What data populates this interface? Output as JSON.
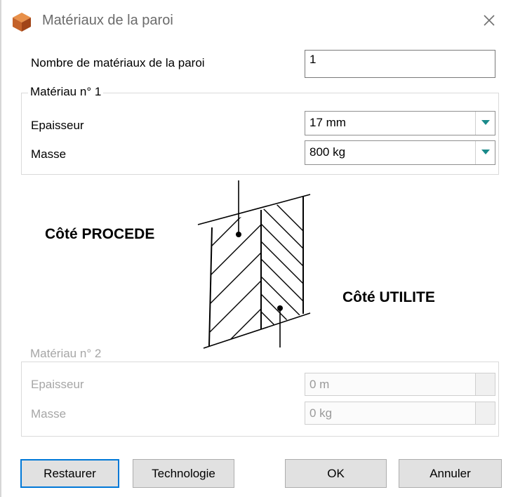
{
  "window": {
    "title": "Matériaux de la paroi",
    "app_icon": "cube-icon",
    "close_icon": "close-icon"
  },
  "count": {
    "label": "Nombre de matériaux de la paroi",
    "value": "1"
  },
  "material1": {
    "legend": "Matériau n° 1",
    "thickness_label": "Epaisseur",
    "thickness_value": "17 mm",
    "mass_label": "Masse",
    "mass_value": "800 kg"
  },
  "diagram": {
    "process_side": "Côté PROCEDE",
    "utility_side": "Côté UTILITE"
  },
  "material2": {
    "legend": "Matériau n° 2",
    "thickness_label": "Epaisseur",
    "thickness_value": "0 m",
    "mass_label": "Masse",
    "mass_value": "0 kg",
    "enabled": false
  },
  "buttons": {
    "restore": "Restaurer",
    "technology": "Technologie",
    "ok": "OK",
    "cancel": "Annuler"
  },
  "colors": {
    "default_button_border": "#0078d7",
    "button_face": "#e1e1e1",
    "dropdown_arrow": "#1a8a8a",
    "disabled_text": "#a6a6a6"
  }
}
